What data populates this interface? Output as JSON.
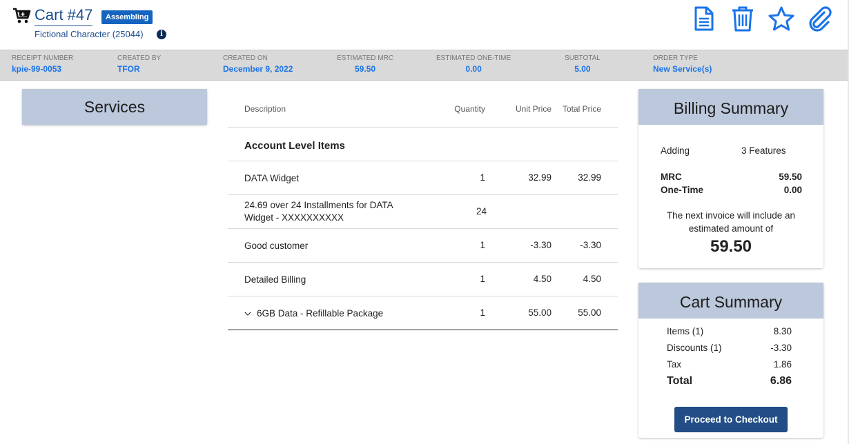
{
  "header": {
    "cart_title": "Cart #47",
    "status": "Assembling",
    "customer": "Fictional Character (25044)",
    "icons": [
      "document-icon",
      "trash-icon",
      "star-icon",
      "paperclip-icon"
    ]
  },
  "info_bar": [
    {
      "label": "RECEIPT NUMBER",
      "value": "kpie-99-0053"
    },
    {
      "label": "CREATED BY",
      "value": "TFOR"
    },
    {
      "label": "CREATED ON",
      "value": "December 9, 2022"
    },
    {
      "label": "ESTIMATED MRC",
      "value": "59.50"
    },
    {
      "label": "ESTIMATED ONE-TIME",
      "value": "0.00"
    },
    {
      "label": "SUBTOTAL",
      "value": "5.00"
    },
    {
      "label": "ORDER TYPE",
      "value": "New Service(s)"
    }
  ],
  "services": {
    "title": "Services"
  },
  "table": {
    "headers": {
      "description": "Description",
      "quantity": "Quantity",
      "unit_price": "Unit Price",
      "total_price": "Total Price"
    },
    "section_title": "Account Level Items",
    "rows": [
      {
        "description": "DATA Widget",
        "quantity": "1",
        "unit_price": "32.99",
        "total_price": "32.99"
      },
      {
        "description": "24.69 over 24 Installments for DATA Widget - XXXXXXXXXX",
        "quantity": "24",
        "unit_price": "",
        "total_price": ""
      },
      {
        "description": "Good customer",
        "quantity": "1",
        "unit_price": "-3.30",
        "total_price": "-3.30"
      },
      {
        "description": "Detailed Billing",
        "quantity": "1",
        "unit_price": "4.50",
        "total_price": "4.50"
      },
      {
        "description": "6GB Data - Refillable Package",
        "quantity": "1",
        "unit_price": "55.00",
        "total_price": "55.00"
      }
    ]
  },
  "billing_summary": {
    "title": "Billing Summary",
    "adding_label": "Adding",
    "adding_value": "3 Features",
    "mrc_label": "MRC",
    "mrc_value": "59.50",
    "onetime_label": "One-Time",
    "onetime_value": "0.00",
    "invoice_note_line1": "The next invoice will include an",
    "invoice_note_line2": "estimated amount of",
    "invoice_amount": "59.50"
  },
  "cart_summary": {
    "title": "Cart Summary",
    "items_label": "Items (1)",
    "items_value": "8.30",
    "discounts_label": "Discounts (1)",
    "discounts_value": "-3.30",
    "tax_label": "Tax",
    "tax_value": "1.86",
    "total_label": "Total",
    "total_value": "6.86",
    "checkout_label": "Proceed to Checkout"
  },
  "colors": {
    "accent": "#1a73e8",
    "badge": "#1565c0",
    "panel_header": "#bcc8db",
    "button": "#224d86",
    "info_bar": "#d9d9d9"
  }
}
